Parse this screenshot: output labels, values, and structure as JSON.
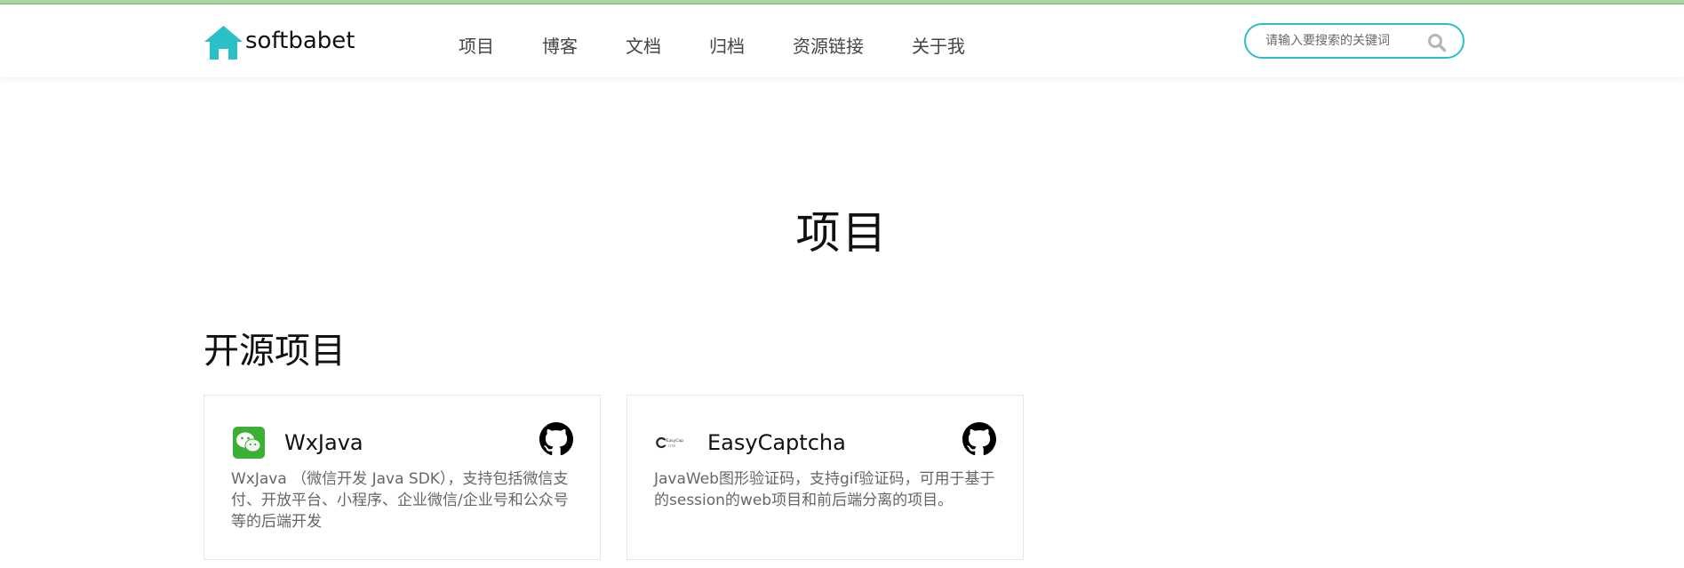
{
  "header": {
    "logo_text": "softbabet",
    "nav": [
      "项目",
      "博客",
      "文档",
      "归档",
      "资源链接",
      "关于我"
    ],
    "search": {
      "placeholder": "请输入要搜索的关键词"
    }
  },
  "main": {
    "page_title": "项目",
    "section_title": "开源项目",
    "projects": [
      {
        "name": "WxJava",
        "description": "WxJava （微信开发 Java SDK），支持包括微信支付、开放平台、小程序、企业微信/企业号和公众号等的后端开发",
        "icon": "wechat-logo-icon"
      },
      {
        "name": "EasyCaptcha",
        "description": "JavaWeb图形验证码，支持gif验证码，可用于基于的session的web项目和前后端分离的项目。",
        "icon": "easycaptcha-logo-icon",
        "logo_lettering": "EasyCaptcha"
      }
    ]
  },
  "colors": {
    "accent": "#2bbfc7",
    "top_strip": "#a9d5a3",
    "wechat_green": "#3cb034"
  }
}
